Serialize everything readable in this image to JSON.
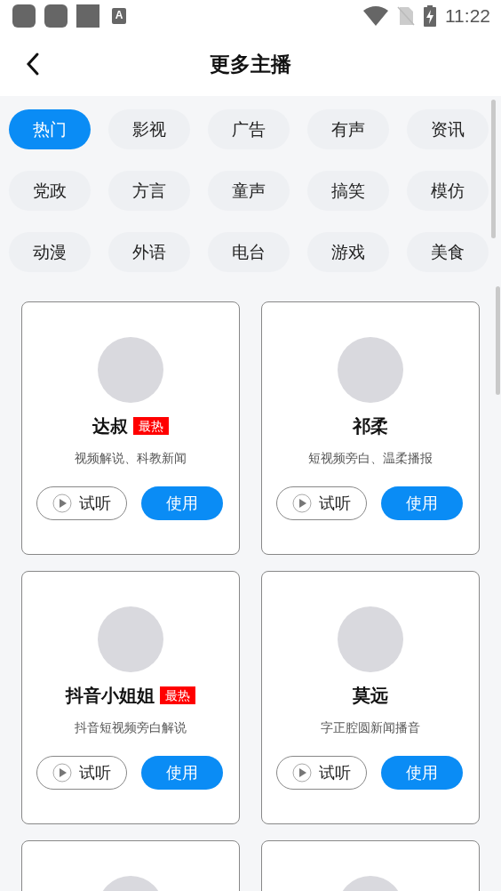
{
  "status_bar": {
    "time": "11:22",
    "notification_glyph": "A"
  },
  "header": {
    "title": "更多主播"
  },
  "categories": [
    {
      "label": "热门",
      "selected": true
    },
    {
      "label": "影视",
      "selected": false
    },
    {
      "label": "广告",
      "selected": false
    },
    {
      "label": "有声",
      "selected": false
    },
    {
      "label": "资讯",
      "selected": false
    },
    {
      "label": "党政",
      "selected": false
    },
    {
      "label": "方言",
      "selected": false
    },
    {
      "label": "童声",
      "selected": false
    },
    {
      "label": "搞笑",
      "selected": false
    },
    {
      "label": "模仿",
      "selected": false
    },
    {
      "label": "动漫",
      "selected": false
    },
    {
      "label": "外语",
      "selected": false
    },
    {
      "label": "电台",
      "selected": false
    },
    {
      "label": "游戏",
      "selected": false
    },
    {
      "label": "美食",
      "selected": false
    }
  ],
  "anchors": [
    {
      "kind": "full",
      "name": "达叔",
      "badge": "最热",
      "description": "视频解说、科教新闻",
      "preview": "试听",
      "use": "使用"
    },
    {
      "kind": "full",
      "name": "祁柔",
      "description": "短视频旁白、温柔播报",
      "preview": "试听",
      "use": "使用"
    },
    {
      "kind": "full",
      "name": "抖音小姐姐",
      "badge": "最热",
      "description": "抖音短视频旁白解说",
      "preview": "试听",
      "use": "使用"
    },
    {
      "kind": "full",
      "name": "莫远",
      "description": "字正腔圆新闻播音",
      "preview": "试听",
      "use": "使用"
    },
    {
      "kind": "partial"
    },
    {
      "kind": "partial"
    }
  ]
}
